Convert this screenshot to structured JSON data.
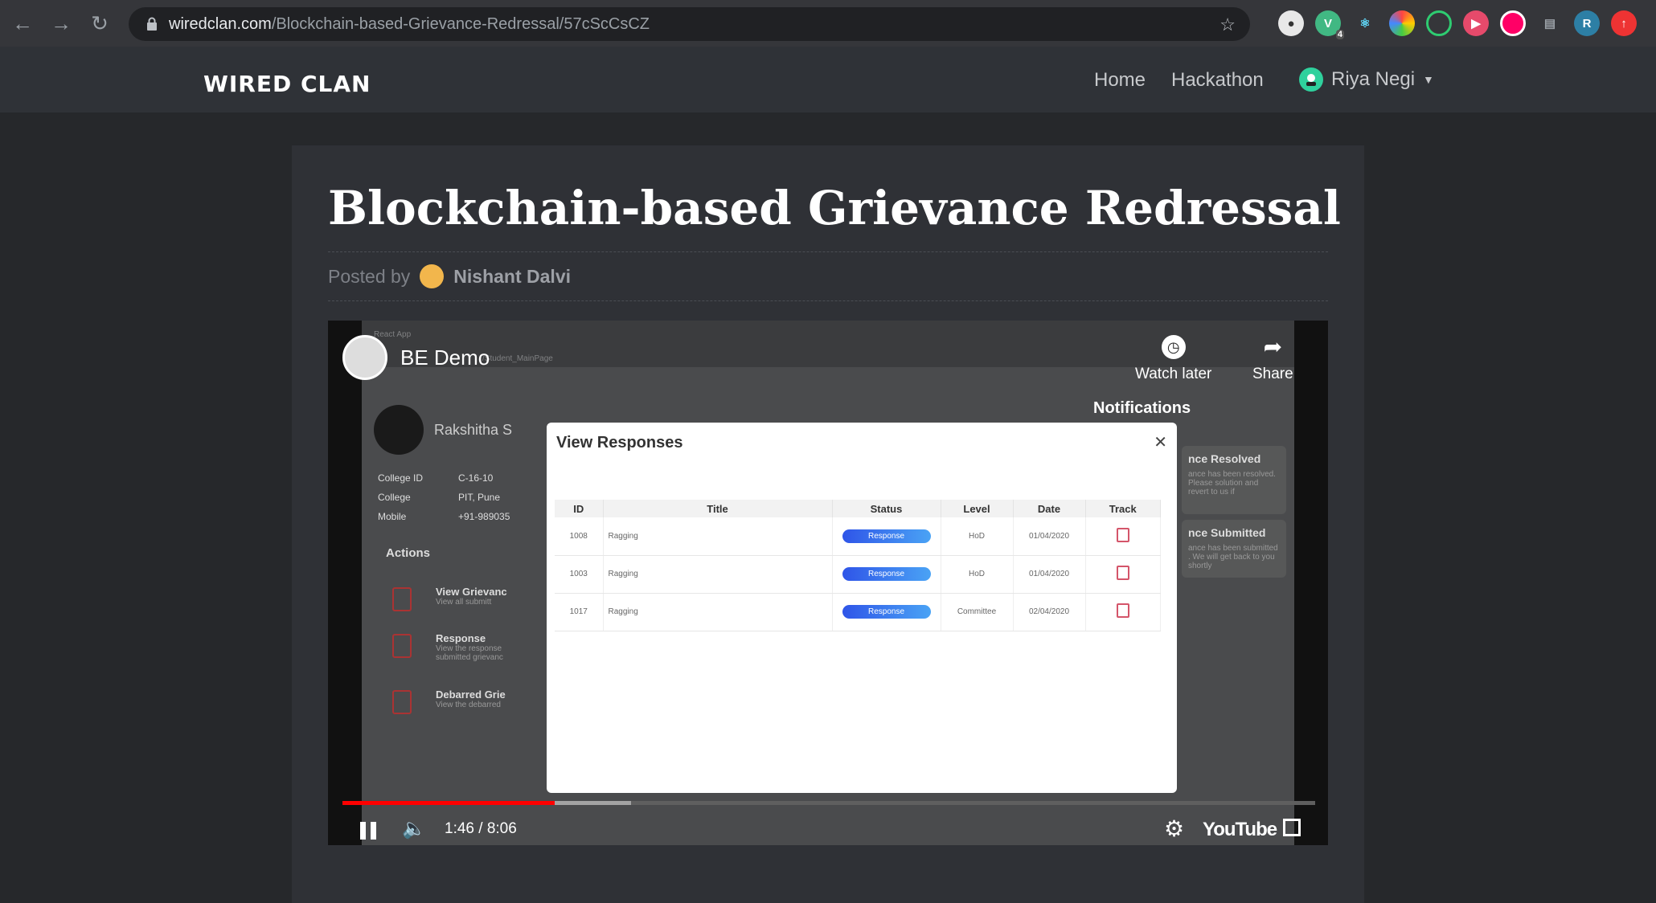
{
  "browser": {
    "url_host": "wiredclan.com",
    "url_path": "/Blockchain-based-Grievance-Redressal/57cScCsCZ",
    "extension_badge": "4",
    "profile_initial": "R"
  },
  "site": {
    "logo": "WIRED CLAN",
    "nav": {
      "home": "Home",
      "hackathon": "Hackathon",
      "user": "Riya Negi"
    }
  },
  "post": {
    "title": "Blockchain-based Grievance Redressal",
    "posted_by_label": "Posted by",
    "author": "Nishant Dalvi"
  },
  "video": {
    "title": "BE Demo",
    "watch_later": "Watch later",
    "share": "Share",
    "time": "1:46 / 8:06",
    "progress_fraction": 0.218,
    "buffered_fraction": 0.297,
    "brand": "YouTube",
    "app": {
      "tab_title": "React App",
      "address": "/Student_MainPage",
      "student_name": "Rakshitha S",
      "profile": [
        {
          "label": "College ID",
          "value": "C-16-10"
        },
        {
          "label": "College",
          "value": "PIT, Pune"
        },
        {
          "label": "Mobile",
          "value": "+91-989035"
        }
      ],
      "actions_heading": "Actions",
      "actions": [
        {
          "title": "View Grievanc",
          "desc": "View all submitt"
        },
        {
          "title": "Response",
          "desc": "View the response submitted grievanc"
        },
        {
          "title": "Debarred Grie",
          "desc": "View the debarred"
        }
      ],
      "notifications_heading": "Notifications",
      "notifications": [
        {
          "title": "nce Resolved",
          "desc": "ance has been resolved. Please solution and revert to us if"
        },
        {
          "title": "nce Submitted",
          "desc": "ance has been submitted . We will get back to you shortly"
        }
      ],
      "modal": {
        "title": "View Responses",
        "columns": [
          "ID",
          "Title",
          "Status",
          "Level",
          "Date",
          "Track"
        ],
        "rows": [
          {
            "id": "1008",
            "title": "Ragging",
            "status": "Response",
            "level": "HoD",
            "date": "01/04/2020"
          },
          {
            "id": "1003",
            "title": "Ragging",
            "status": "Response",
            "level": "HoD",
            "date": "01/04/2020"
          },
          {
            "id": "1017",
            "title": "Ragging",
            "status": "Response",
            "level": "Committee",
            "date": "02/04/2020"
          }
        ]
      }
    }
  },
  "colors": {
    "accent": "#ff0000",
    "page_bg": "#26282b",
    "header_bg": "#2f3237"
  }
}
